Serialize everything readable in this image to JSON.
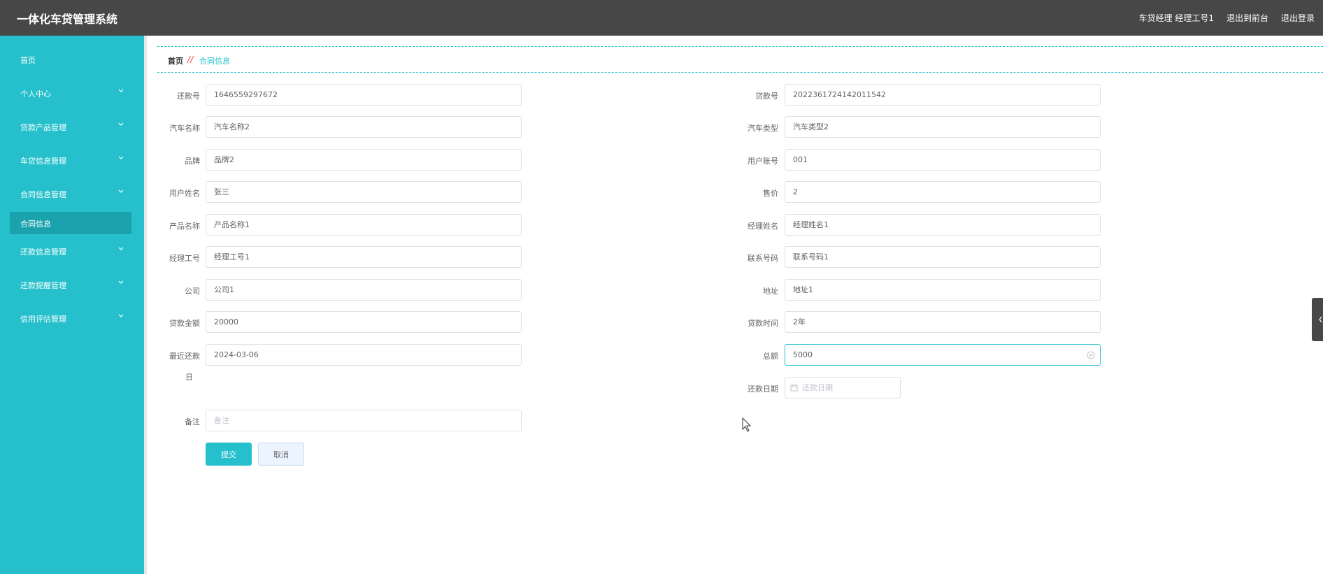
{
  "header": {
    "title": "一体化车贷管理系统",
    "user": "车贷经理 经理工号1",
    "to_front": "退出到前台",
    "logout": "退出登录"
  },
  "sidebar": {
    "items": [
      {
        "label": "首页"
      },
      {
        "label": "个人中心"
      },
      {
        "label": "贷款产品管理"
      },
      {
        "label": "车贷信息管理"
      },
      {
        "label": "合同信息管理"
      },
      {
        "label": "还款信息管理"
      },
      {
        "label": "还款提醒管理"
      },
      {
        "label": "信用评估管理"
      }
    ],
    "active_sub": "合同信息"
  },
  "breadcrumb": {
    "home": "首页",
    "separator": "//",
    "current": "合同信息"
  },
  "form": {
    "left": [
      {
        "label": "还款号",
        "value": "1646559297672"
      },
      {
        "label": "汽车名称",
        "value": "汽车名称2"
      },
      {
        "label": "品牌",
        "value": "品牌2"
      },
      {
        "label": "用户姓名",
        "value": "张三"
      },
      {
        "label": "产品名称",
        "value": "产品名称1"
      },
      {
        "label": "经理工号",
        "value": "经理工号1"
      },
      {
        "label": "公司",
        "value": "公司1"
      },
      {
        "label": "贷款金额",
        "value": "20000"
      },
      {
        "label_line1": "最近还款",
        "label_line2": "日",
        "value": "2024-03-06"
      }
    ],
    "right": [
      {
        "label": "贷款号",
        "value": "2022361724142011542"
      },
      {
        "label": "汽车类型",
        "value": "汽车类型2"
      },
      {
        "label": "用户账号",
        "value": "001"
      },
      {
        "label": "售价",
        "value": "2"
      },
      {
        "label": "经理姓名",
        "value": "经理姓名1"
      },
      {
        "label": "联系号码",
        "value": "联系号码1"
      },
      {
        "label": "地址",
        "value": "地址1"
      },
      {
        "label": "贷款时间",
        "value": "2年"
      },
      {
        "label": "总额",
        "value": "5000"
      }
    ],
    "repay_date": {
      "label": "还款日期",
      "placeholder": "还款日期"
    },
    "remark": {
      "label": "备注",
      "placeholder": "备注"
    },
    "submit": "提交",
    "cancel": "取消"
  },
  "colors": {
    "accent": "#25c0cc",
    "topbar": "#474747",
    "sidebar_active": "#1aa3ad"
  }
}
